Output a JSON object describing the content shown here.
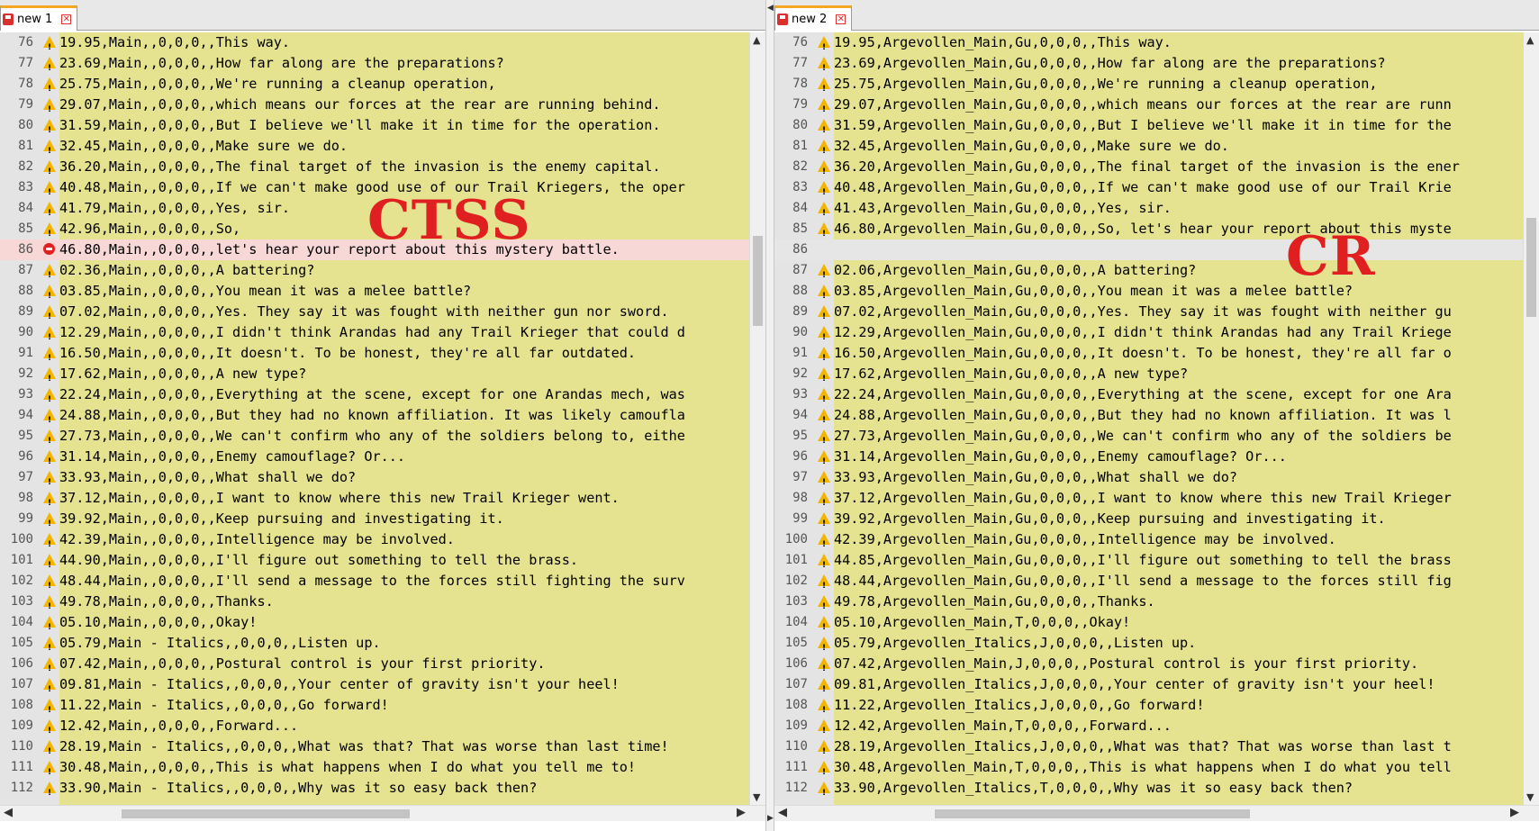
{
  "left": {
    "tab_title": "new 1",
    "overlay_label": "CTSS",
    "lines": [
      {
        "n": "76",
        "mark": "warn",
        "text": "19.95,Main,,0,0,0,,This way."
      },
      {
        "n": "77",
        "mark": "warn",
        "text": "23.69,Main,,0,0,0,,How far along are the preparations?"
      },
      {
        "n": "78",
        "mark": "warn",
        "text": "25.75,Main,,0,0,0,,We're running a cleanup operation,"
      },
      {
        "n": "79",
        "mark": "warn",
        "text": "29.07,Main,,0,0,0,,which means our forces at the rear are running behind."
      },
      {
        "n": "80",
        "mark": "warn",
        "text": "31.59,Main,,0,0,0,,But I believe we'll make it in time for the operation."
      },
      {
        "n": "81",
        "mark": "warn",
        "text": "32.45,Main,,0,0,0,,Make sure we do."
      },
      {
        "n": "82",
        "mark": "warn",
        "text": "36.20,Main,,0,0,0,,The final target of the invasion is the enemy capital."
      },
      {
        "n": "83",
        "mark": "warn",
        "text": "40.48,Main,,0,0,0,,If we can't make good use of our Trail Kriegers, the oper"
      },
      {
        "n": "84",
        "mark": "warn",
        "text": "41.79,Main,,0,0,0,,Yes, sir."
      },
      {
        "n": "85",
        "mark": "warn",
        "text": "42.96,Main,,0,0,0,,So,"
      },
      {
        "n": "86",
        "mark": "err",
        "text": "46.80,Main,,0,0,0,,let's hear your report about this mystery battle."
      },
      {
        "n": "87",
        "mark": "warn",
        "text": "02.36,Main,,0,0,0,,A battering?"
      },
      {
        "n": "88",
        "mark": "warn",
        "text": "03.85,Main,,0,0,0,,You mean it was a melee battle?"
      },
      {
        "n": "89",
        "mark": "warn",
        "text": "07.02,Main,,0,0,0,,Yes. They say it was fought with neither gun nor sword."
      },
      {
        "n": "90",
        "mark": "warn",
        "text": "12.29,Main,,0,0,0,,I didn't think Arandas had any Trail Krieger that could d"
      },
      {
        "n": "91",
        "mark": "warn",
        "text": "16.50,Main,,0,0,0,,It doesn't. To be honest, they're all far outdated."
      },
      {
        "n": "92",
        "mark": "warn",
        "text": "17.62,Main,,0,0,0,,A new type?"
      },
      {
        "n": "93",
        "mark": "warn",
        "text": "22.24,Main,,0,0,0,,Everything at the scene, except for one Arandas mech, was"
      },
      {
        "n": "94",
        "mark": "warn",
        "text": "24.88,Main,,0,0,0,,But they had no known affiliation. It was likely camoufla"
      },
      {
        "n": "95",
        "mark": "warn",
        "text": "27.73,Main,,0,0,0,,We can't confirm who any of the soldiers belong to, eithe"
      },
      {
        "n": "96",
        "mark": "warn",
        "text": "31.14,Main,,0,0,0,,Enemy camouflage? Or..."
      },
      {
        "n": "97",
        "mark": "warn",
        "text": "33.93,Main,,0,0,0,,What shall we do?"
      },
      {
        "n": "98",
        "mark": "warn",
        "text": "37.12,Main,,0,0,0,,I want to know where this new Trail Krieger went."
      },
      {
        "n": "99",
        "mark": "warn",
        "text": "39.92,Main,,0,0,0,,Keep pursuing and investigating it."
      },
      {
        "n": "100",
        "mark": "warn",
        "text": "42.39,Main,,0,0,0,,Intelligence may be involved."
      },
      {
        "n": "101",
        "mark": "warn",
        "text": "44.90,Main,,0,0,0,,I'll figure out something to tell the brass."
      },
      {
        "n": "102",
        "mark": "warn",
        "text": "48.44,Main,,0,0,0,,I'll send a message to the forces still fighting the surv"
      },
      {
        "n": "103",
        "mark": "warn",
        "text": "49.78,Main,,0,0,0,,Thanks."
      },
      {
        "n": "104",
        "mark": "warn",
        "text": "05.10,Main,,0,0,0,,Okay!"
      },
      {
        "n": "105",
        "mark": "warn",
        "text": "05.79,Main - Italics,,0,0,0,,Listen up."
      },
      {
        "n": "106",
        "mark": "warn",
        "text": "07.42,Main,,0,0,0,,Postural control is your first priority."
      },
      {
        "n": "107",
        "mark": "warn",
        "text": "09.81,Main - Italics,,0,0,0,,Your center of gravity isn't your heel!"
      },
      {
        "n": "108",
        "mark": "warn",
        "text": "11.22,Main - Italics,,0,0,0,,Go forward!"
      },
      {
        "n": "109",
        "mark": "warn",
        "text": "12.42,Main,,0,0,0,,Forward..."
      },
      {
        "n": "110",
        "mark": "warn",
        "text": "28.19,Main - Italics,,0,0,0,,What was that? That was worse than last time!"
      },
      {
        "n": "111",
        "mark": "warn",
        "text": "30.48,Main,,0,0,0,,This is what happens when I do what you tell me to!"
      },
      {
        "n": "112",
        "mark": "warn",
        "text": "33.90,Main - Italics,,0,0,0,,Why was it so easy back then?"
      }
    ]
  },
  "right": {
    "tab_title": "new 2",
    "overlay_label": "CR",
    "lines": [
      {
        "n": "76",
        "mark": "warn",
        "text": "19.95,Argevollen_Main,Gu,0,0,0,,This way."
      },
      {
        "n": "77",
        "mark": "warn",
        "text": "23.69,Argevollen_Main,Gu,0,0,0,,How far along are the preparations?"
      },
      {
        "n": "78",
        "mark": "warn",
        "text": "25.75,Argevollen_Main,Gu,0,0,0,,We're running a cleanup operation,"
      },
      {
        "n": "79",
        "mark": "warn",
        "text": "29.07,Argevollen_Main,Gu,0,0,0,,which means our forces at the rear are runn"
      },
      {
        "n": "80",
        "mark": "warn",
        "text": "31.59,Argevollen_Main,Gu,0,0,0,,But I believe we'll make it in time for the"
      },
      {
        "n": "81",
        "mark": "warn",
        "text": "32.45,Argevollen_Main,Gu,0,0,0,,Make sure we do."
      },
      {
        "n": "82",
        "mark": "warn",
        "text": "36.20,Argevollen_Main,Gu,0,0,0,,The final target of the invasion is the ener"
      },
      {
        "n": "83",
        "mark": "warn",
        "text": "40.48,Argevollen_Main,Gu,0,0,0,,If we can't make good use of our Trail Krie"
      },
      {
        "n": "84",
        "mark": "warn",
        "text": "41.43,Argevollen_Main,Gu,0,0,0,,Yes, sir."
      },
      {
        "n": "85",
        "mark": "warn",
        "text": "46.80,Argevollen_Main,Gu,0,0,0,,So, let's hear your report about this myste"
      },
      {
        "n": "86",
        "mark": "gap",
        "text": ""
      },
      {
        "n": "87",
        "mark": "warn",
        "text": "02.06,Argevollen_Main,Gu,0,0,0,,A battering?"
      },
      {
        "n": "88",
        "mark": "warn",
        "text": "03.85,Argevollen_Main,Gu,0,0,0,,You mean it was a melee battle?"
      },
      {
        "n": "89",
        "mark": "warn",
        "text": "07.02,Argevollen_Main,Gu,0,0,0,,Yes. They say it was fought with neither gu"
      },
      {
        "n": "90",
        "mark": "warn",
        "text": "12.29,Argevollen_Main,Gu,0,0,0,,I didn't think Arandas had any Trail Kriege"
      },
      {
        "n": "91",
        "mark": "warn",
        "text": "16.50,Argevollen_Main,Gu,0,0,0,,It doesn't. To be honest, they're all far o"
      },
      {
        "n": "92",
        "mark": "warn",
        "text": "17.62,Argevollen_Main,Gu,0,0,0,,A new type?"
      },
      {
        "n": "93",
        "mark": "warn",
        "text": "22.24,Argevollen_Main,Gu,0,0,0,,Everything at the scene, except for one Ara"
      },
      {
        "n": "94",
        "mark": "warn",
        "text": "24.88,Argevollen_Main,Gu,0,0,0,,But they had no known affiliation. It was l"
      },
      {
        "n": "95",
        "mark": "warn",
        "text": "27.73,Argevollen_Main,Gu,0,0,0,,We can't confirm who any of the soldiers be"
      },
      {
        "n": "96",
        "mark": "warn",
        "text": "31.14,Argevollen_Main,Gu,0,0,0,,Enemy camouflage? Or..."
      },
      {
        "n": "97",
        "mark": "warn",
        "text": "33.93,Argevollen_Main,Gu,0,0,0,,What shall we do?"
      },
      {
        "n": "98",
        "mark": "warn",
        "text": "37.12,Argevollen_Main,Gu,0,0,0,,I want to know where this new Trail Krieger"
      },
      {
        "n": "99",
        "mark": "warn",
        "text": "39.92,Argevollen_Main,Gu,0,0,0,,Keep pursuing and investigating it."
      },
      {
        "n": "100",
        "mark": "warn",
        "text": "42.39,Argevollen_Main,Gu,0,0,0,,Intelligence may be involved."
      },
      {
        "n": "101",
        "mark": "warn",
        "text": "44.85,Argevollen_Main,Gu,0,0,0,,I'll figure out something to tell the brass"
      },
      {
        "n": "102",
        "mark": "warn",
        "text": "48.44,Argevollen_Main,Gu,0,0,0,,I'll send a message to the forces still fig"
      },
      {
        "n": "103",
        "mark": "warn",
        "text": "49.78,Argevollen_Main,Gu,0,0,0,,Thanks."
      },
      {
        "n": "104",
        "mark": "warn",
        "text": "05.10,Argevollen_Main,T,0,0,0,,Okay!"
      },
      {
        "n": "105",
        "mark": "warn",
        "text": "05.79,Argevollen_Italics,J,0,0,0,,Listen up."
      },
      {
        "n": "106",
        "mark": "warn",
        "text": "07.42,Argevollen_Main,J,0,0,0,,Postural control is your first priority."
      },
      {
        "n": "107",
        "mark": "warn",
        "text": "09.81,Argevollen_Italics,J,0,0,0,,Your center of gravity isn't your heel!"
      },
      {
        "n": "108",
        "mark": "warn",
        "text": "11.22,Argevollen_Italics,J,0,0,0,,Go forward!"
      },
      {
        "n": "109",
        "mark": "warn",
        "text": "12.42,Argevollen_Main,T,0,0,0,,Forward..."
      },
      {
        "n": "110",
        "mark": "warn",
        "text": "28.19,Argevollen_Italics,J,0,0,0,,What was that? That was worse than last t"
      },
      {
        "n": "111",
        "mark": "warn",
        "text": "30.48,Argevollen_Main,T,0,0,0,,This is what happens when I do what you tell"
      },
      {
        "n": "112",
        "mark": "warn",
        "text": "33.90,Argevollen_Italics,T,0,0,0,,Why was it so easy back then?"
      }
    ]
  },
  "colors": {
    "editor_bg": "#e5e38f",
    "error_line": "#f8d7d7",
    "label_red": "#e02020"
  }
}
